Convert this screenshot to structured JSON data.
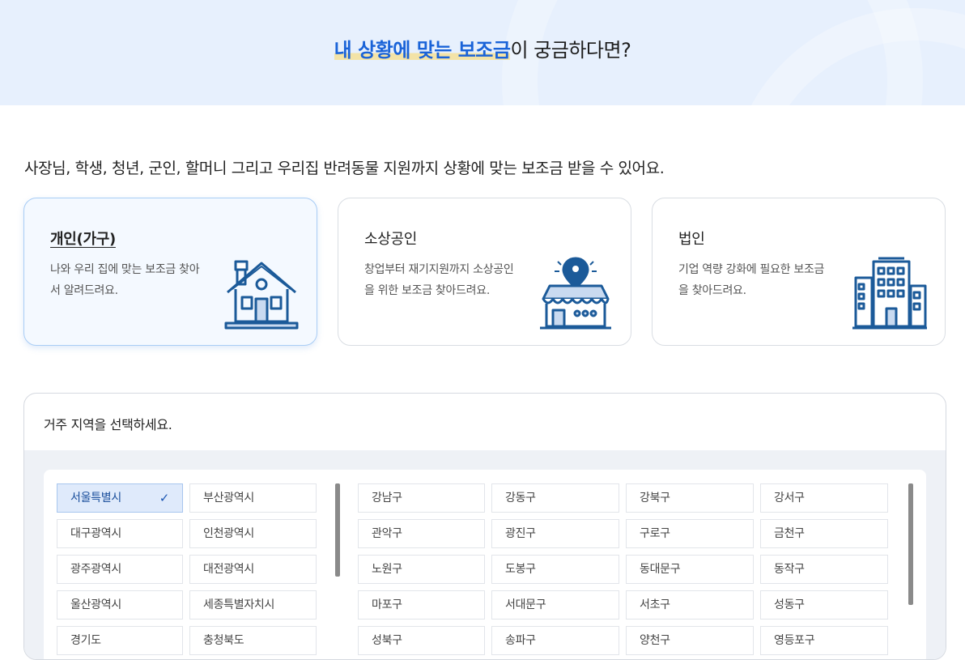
{
  "hero": {
    "highlight": "내 상황에 맞는 보조금",
    "rest": "이 궁금하다면?"
  },
  "intro": "사장님, 학생, 청년, 군인, 할머니 그리고 우리집 반려동물 지원까지 상황에 맞는 보조금 받을 수 있어요.",
  "cards": [
    {
      "title": "개인(가구)",
      "desc": "나와 우리 집에 맞는 보조금 찾아서 알려드려요.",
      "icon": "house-icon",
      "active": true
    },
    {
      "title": "소상공인",
      "desc": "창업부터 재기지원까지 소상공인을 위한 보조금 찾아드려요.",
      "icon": "store-icon",
      "active": false
    },
    {
      "title": "법인",
      "desc": "기업 역량 강화에 필요한 보조금을 찾아드려요.",
      "icon": "building-icon",
      "active": false
    }
  ],
  "region": {
    "heading": "거주 지역을 선택하세요.",
    "provinces": [
      "서울특별시",
      "부산광역시",
      "대구광역시",
      "인천광역시",
      "광주광역시",
      "대전광역시",
      "울산광역시",
      "세종특별자치시",
      "경기도",
      "충청북도"
    ],
    "selected_province": "서울특별시",
    "districts": [
      "강남구",
      "강동구",
      "강북구",
      "강서구",
      "관악구",
      "광진구",
      "구로구",
      "금천구",
      "노원구",
      "도봉구",
      "동대문구",
      "동작구",
      "마포구",
      "서대문구",
      "서초구",
      "성동구",
      "성북구",
      "송파구",
      "양천구",
      "영등포구"
    ]
  },
  "colors": {
    "accent": "#1a63d8",
    "icon_blue": "#1b5a99",
    "selected_bg": "#dfeafb"
  }
}
